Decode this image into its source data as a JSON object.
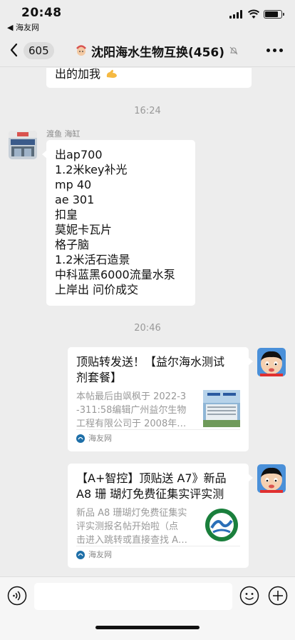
{
  "status_bar": {
    "time": "20:48",
    "back_app": "◀ 海友网",
    "battery_level": 0.85
  },
  "nav": {
    "back_count": "605",
    "title": "沈阳海水生物互换(456)",
    "more_label": "···"
  },
  "messages": {
    "partial_top": {
      "text": "出的加我"
    },
    "time_1": "16:24",
    "sender_1": {
      "name": "渡鱼 海缸",
      "lines": [
        "出ap700",
        "1.2米key补光",
        "mp 40",
        "ae 301",
        "扣皇",
        "莫妮卡瓦片",
        "格子脑",
        "1.2米活石造景",
        "中科蓝黑6000流量水泵",
        "上岸出  问价成交"
      ]
    },
    "time_2": "20:46",
    "card_1": {
      "title_line1": "顶贴转发送！【益尔海水测试",
      "title_line2": "剂套餐】",
      "desc_line1": "本帖最后由飒枫于 2022-3",
      "desc_line2": "-311:58编辑广州益尔生物",
      "desc_line3": "工程有限公司于 2008年…",
      "source": "海友网"
    },
    "card_2": {
      "title_line1": "【A+智控】顶贴送 A7》新品",
      "title_line2": "A8 珊 瑚灯免费征集实评实测",
      "desc_line1": "新品 A8 珊瑚灯免费征集实",
      "desc_line2": "评实测报名帖开始啦（点",
      "desc_line3": "击进入跳转或直接查找 A…",
      "source": "海友网"
    }
  },
  "input_bar": {
    "placeholder": ""
  },
  "colors": {
    "background": "#ededed",
    "bubble": "#ffffff",
    "timestamp": "#999999",
    "source_green": "#1aad19"
  }
}
